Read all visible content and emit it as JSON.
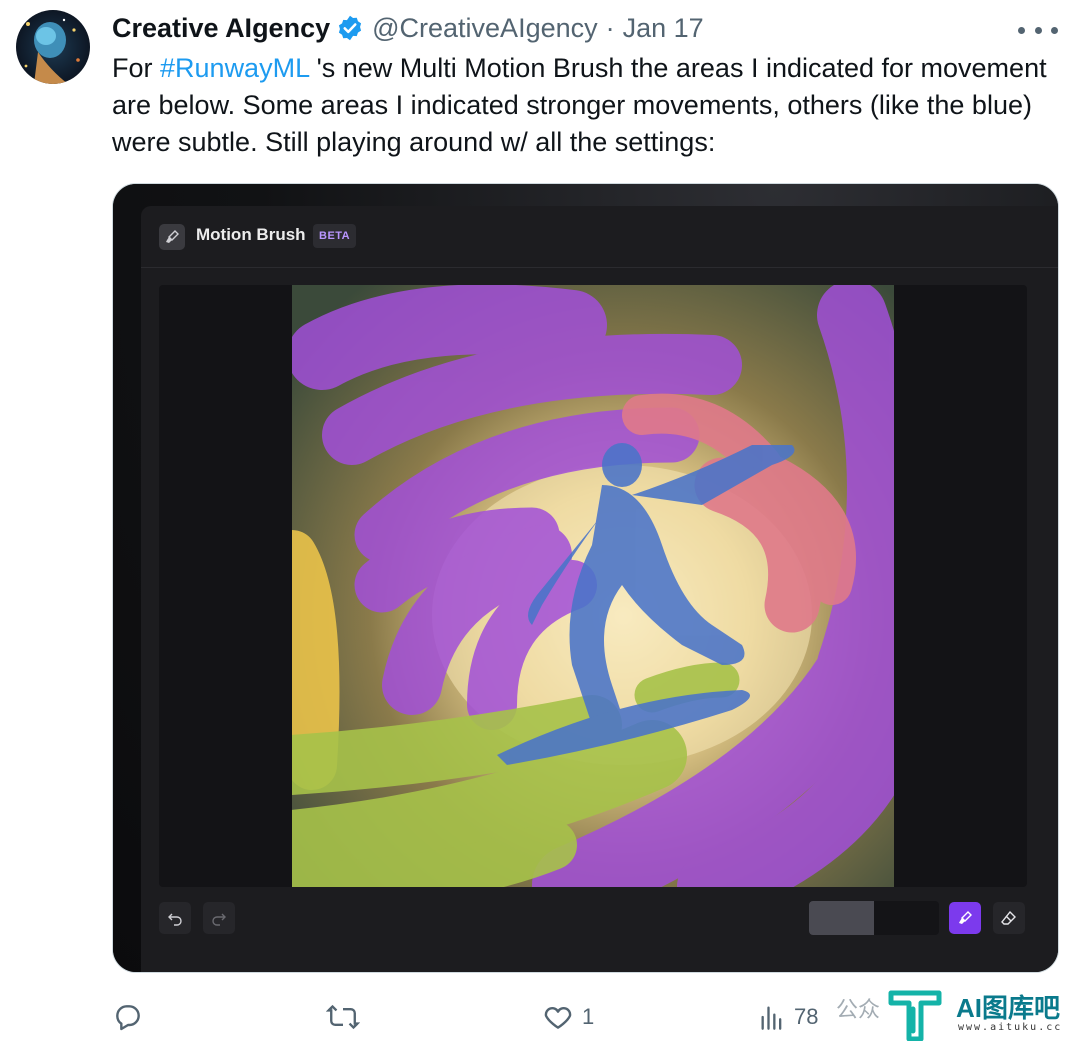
{
  "author": {
    "name": "Creative AIgency",
    "handle": "@CreativeAIgency",
    "separator": "·",
    "date": "Jan 17",
    "verified": true
  },
  "tweet": {
    "text_before": "For ",
    "hashtag": "#RunwayML",
    "text_after": " 's new Multi Motion Brush the areas I indicated for movement are below.  Some areas I indicated stronger movements, others (like the blue) were subtle.  Still playing around w/ all the settings:"
  },
  "media": {
    "app_title": "Motion Brush",
    "badge": "BETA",
    "brush_size_fraction": 0.5,
    "accent_color": "#7c3aed"
  },
  "actions": {
    "reply_count": "",
    "retweet_count": "",
    "like_count": "1",
    "views_count": "78"
  },
  "watermark": {
    "wechat_text": "公众",
    "title": "AI图库吧",
    "url": "www.aituku.cc"
  },
  "icons": {
    "verified": "verified-badge-icon",
    "more": "more-dots-icon",
    "reply": "reply-icon",
    "retweet": "retweet-icon",
    "like": "heart-icon",
    "views": "views-icon",
    "brush": "paintbrush-icon",
    "undo": "undo-icon",
    "redo": "redo-icon",
    "eraser": "eraser-icon"
  }
}
